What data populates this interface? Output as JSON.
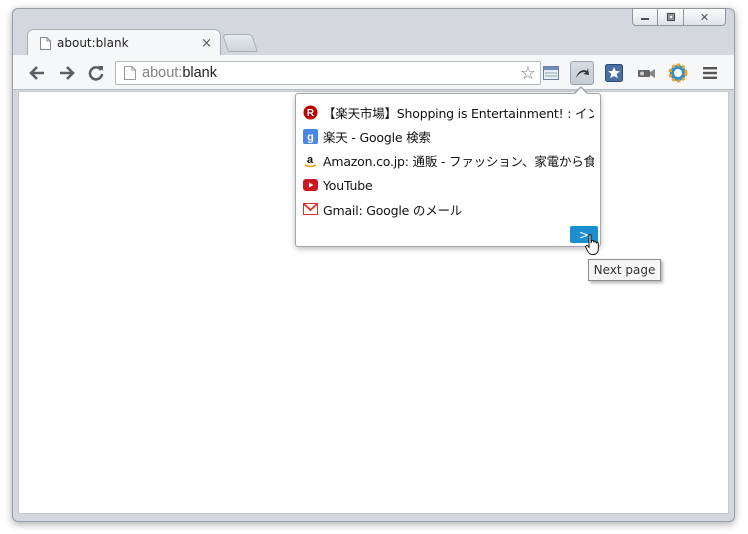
{
  "window": {
    "caption_buttons": {
      "minimize": "▭",
      "restore": "⧉",
      "close": "✕"
    }
  },
  "tab": {
    "title": "about:blank",
    "close": "×"
  },
  "toolbar": {
    "back": "←",
    "forward": "→",
    "reload": "C",
    "url_scheme": "about:",
    "url_rest": "blank",
    "star": "☆",
    "menu_icon": "hamburger-menu-icon"
  },
  "popup": {
    "items": [
      {
        "label": "【楽天市場】Shopping is Entertainment! : イン",
        "icon": "rakuten-favicon",
        "color": "#bf0000"
      },
      {
        "label": "楽天 - Google 検索",
        "icon": "google-favicon",
        "color": "#4a86e8"
      },
      {
        "label": "Amazon.co.jp: 通販 - ファッション、家電から食品",
        "icon": "amazon-favicon",
        "color": "#ff9900"
      },
      {
        "label": "YouTube",
        "icon": "youtube-favicon",
        "color": "#cc181e"
      },
      {
        "label": "Gmail: Google のメール",
        "icon": "gmail-favicon",
        "color": "#d93025"
      }
    ],
    "next_button": ">",
    "tooltip": "Next page"
  },
  "colors": {
    "accent": "#1c8fd0",
    "frame": "#d4d8de",
    "toolbar": "#f6f7f9"
  }
}
